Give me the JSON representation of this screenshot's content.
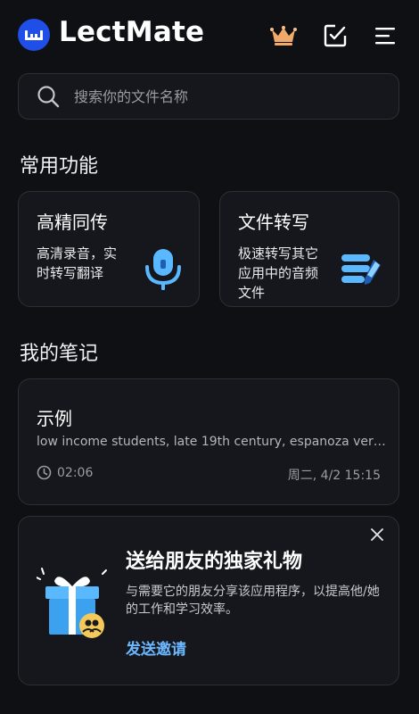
{
  "app": {
    "title": "LectMate"
  },
  "search": {
    "placeholder": "搜索你的文件名称"
  },
  "sections": {
    "features_title": "常用功能",
    "notes_title": "我的笔记"
  },
  "features": [
    {
      "title": "高精同传",
      "desc_line1": "高清录音，实",
      "desc_line2": "时转写翻译",
      "icon": "microphone-icon"
    },
    {
      "title": "文件转写",
      "desc_line1": "极速转写其它",
      "desc_line2": "应用中的音频",
      "desc_line3": "文件",
      "icon": "document-pen-icon"
    }
  ],
  "note": {
    "title": "示例",
    "subtitle": "low income students, late 19th century, espanoza vers...",
    "duration": "02:06",
    "date": "周二, 4/2 15:15"
  },
  "promo": {
    "title": "送给朋友的独家礼物",
    "desc": "与需要它的朋友分享该应用程序，以提高他/她的工作和学习效率。",
    "link": "发送邀请"
  },
  "colors": {
    "background": "#0f1014",
    "card": "#16171c",
    "accent": "#6bb8ff",
    "crown": "#f0a968",
    "logo": "#1f4fe8"
  }
}
